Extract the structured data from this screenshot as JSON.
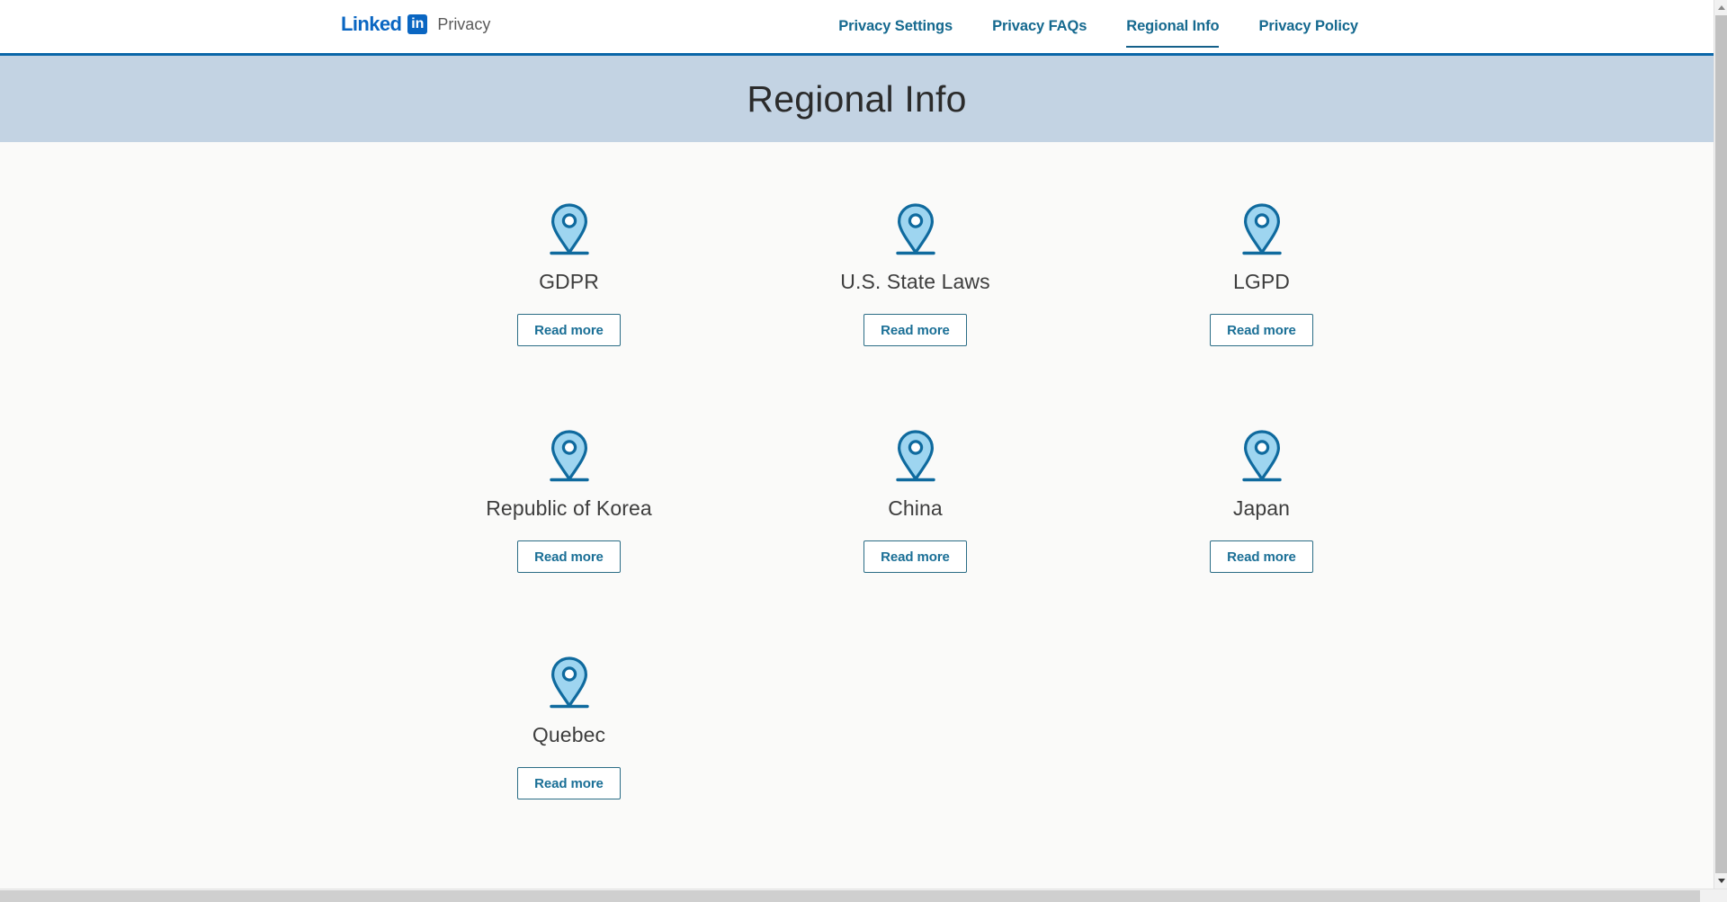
{
  "header": {
    "brand": {
      "linked_text": "Linked",
      "in_text": "in",
      "sub_text": "Privacy",
      "logo_color": "#0a66c2"
    },
    "nav": [
      {
        "label": "Privacy Settings",
        "active": false
      },
      {
        "label": "Privacy FAQs",
        "active": false
      },
      {
        "label": "Regional Info",
        "active": true
      },
      {
        "label": "Privacy Policy",
        "active": false
      }
    ],
    "accent_border_color": "#0a66a8",
    "nav_link_color": "#15698f"
  },
  "hero": {
    "title": "Regional Info",
    "background_color": "#c3d3e3",
    "title_color": "#2b2b2b"
  },
  "main": {
    "background_color": "#fafaf9",
    "button_label": "Read more",
    "icon_name": "map-pin-icon",
    "pin_fill_color": "#9ed5f0",
    "pin_stroke_color": "#0f6a9e",
    "regions": [
      {
        "name": "GDPR",
        "button": "Read more"
      },
      {
        "name": "U.S. State Laws",
        "button": "Read more"
      },
      {
        "name": "LGPD",
        "button": "Read more"
      },
      {
        "name": "Republic of Korea",
        "button": "Read more"
      },
      {
        "name": "China",
        "button": "Read more"
      },
      {
        "name": "Japan",
        "button": "Read more"
      },
      {
        "name": "Quebec",
        "button": "Read more"
      }
    ]
  },
  "scrollbars": {
    "vertical_present": true,
    "horizontal_present": true
  }
}
